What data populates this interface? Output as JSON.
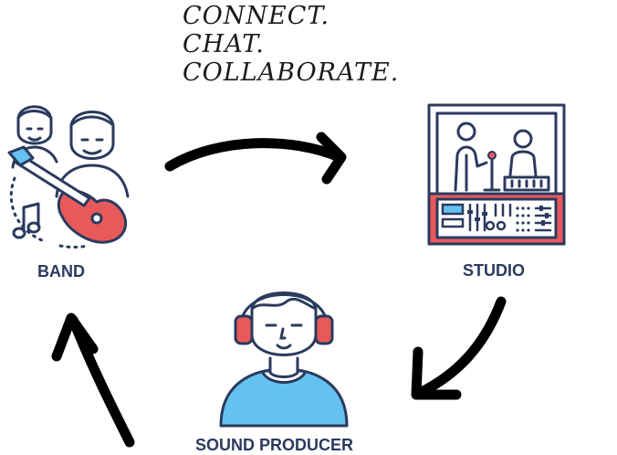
{
  "tagline": {
    "line1": "CONNECT.",
    "line2": "CHAT.",
    "line3": "COLLABORATE."
  },
  "nodes": {
    "band": {
      "label": "BAND",
      "icon": "band-guitar-icon"
    },
    "studio": {
      "label": "STUDIO",
      "icon": "studio-recording-icon"
    },
    "producer": {
      "label": "SOUND PRODUCER",
      "icon": "headphones-producer-icon"
    }
  },
  "colors": {
    "outline": "#2b3a5e",
    "red": "#e85a5a",
    "blue": "#64c2f0",
    "arrow": "#000000"
  }
}
